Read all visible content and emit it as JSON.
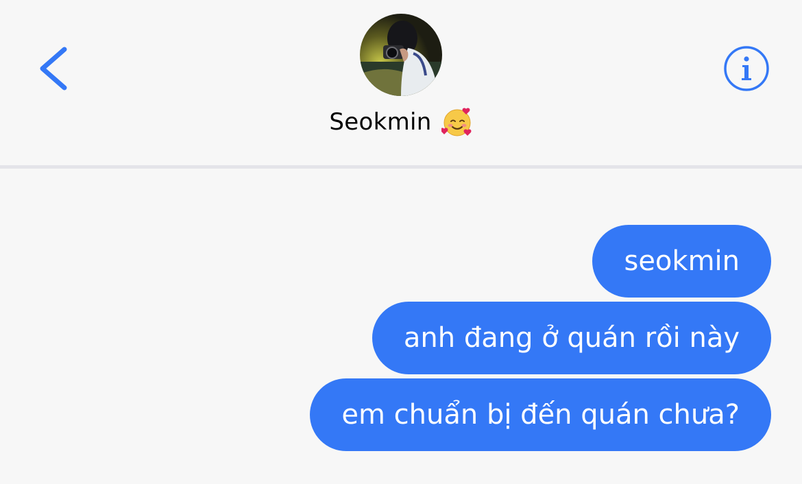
{
  "header": {
    "contact_name": "Seokmin",
    "name_emoji": "smiling-face-with-hearts",
    "back_icon": "chevron-left-icon",
    "info_icon": "info-icon",
    "avatar": "contact-photo",
    "accent_color": "#3478f6"
  },
  "messages": [
    {
      "sender": "me",
      "text": "seokmin"
    },
    {
      "sender": "me",
      "text": "anh đang ở quán rồi này"
    },
    {
      "sender": "me",
      "text": "em chuẩn bị đến quán chưa?"
    }
  ],
  "colors": {
    "background": "#f7f7f7",
    "bubble": "#3478f6",
    "bubble_text": "#ffffff",
    "divider": "#e4e4e9"
  }
}
